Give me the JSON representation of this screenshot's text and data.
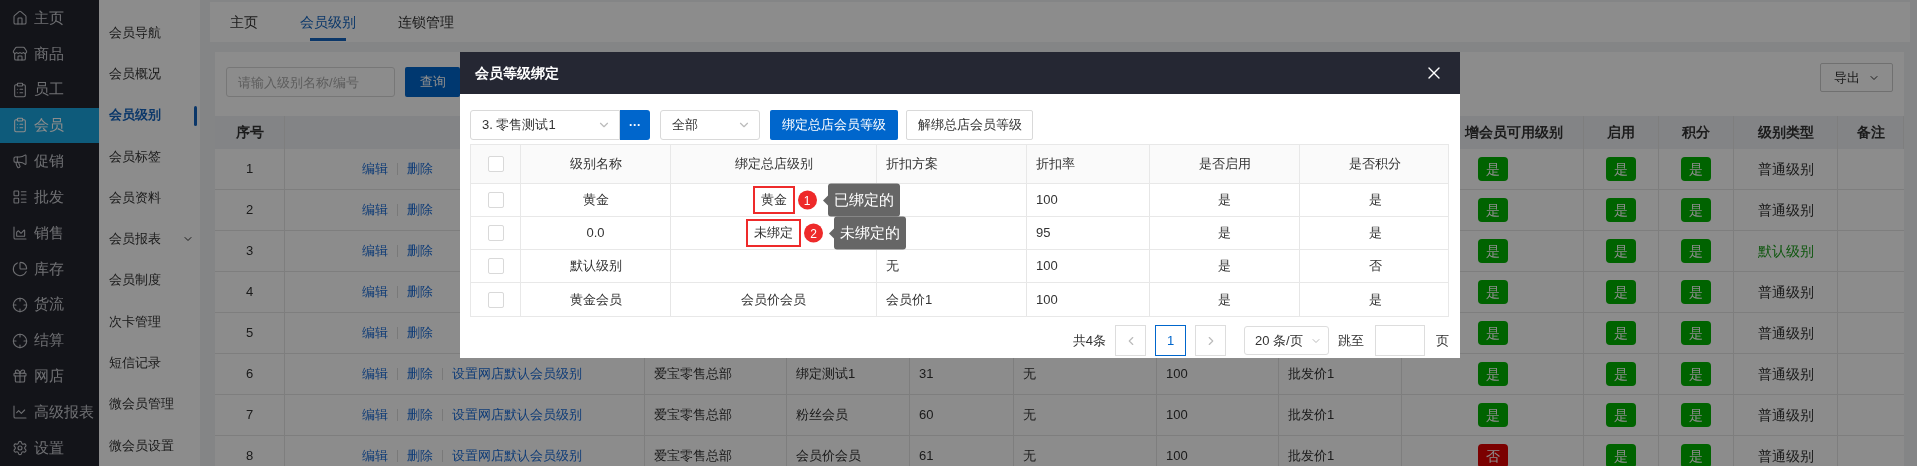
{
  "sidebar": {
    "items": [
      {
        "label": "主页",
        "selected": false
      },
      {
        "label": "商品",
        "selected": false
      },
      {
        "label": "员工",
        "selected": false
      },
      {
        "label": "会员",
        "selected": true
      },
      {
        "label": "促销",
        "selected": false
      },
      {
        "label": "批发",
        "selected": false
      },
      {
        "label": "销售",
        "selected": false
      },
      {
        "label": "库存",
        "selected": false
      },
      {
        "label": "货流",
        "selected": false
      },
      {
        "label": "结算",
        "selected": false
      },
      {
        "label": "网店",
        "selected": false
      },
      {
        "label": "高级报表",
        "selected": false
      },
      {
        "label": "设置",
        "selected": false
      }
    ]
  },
  "subnav": {
    "items": [
      {
        "label": "会员导航",
        "selected": false,
        "expandable": false
      },
      {
        "label": "会员概况",
        "selected": false,
        "expandable": false
      },
      {
        "label": "会员级别",
        "selected": true,
        "expandable": false
      },
      {
        "label": "会员标签",
        "selected": false,
        "expandable": false
      },
      {
        "label": "会员资料",
        "selected": false,
        "expandable": false
      },
      {
        "label": "会员报表",
        "selected": false,
        "expandable": true
      },
      {
        "label": "会员制度",
        "selected": false,
        "expandable": false
      },
      {
        "label": "次卡管理",
        "selected": false,
        "expandable": false
      },
      {
        "label": "短信记录",
        "selected": false,
        "expandable": false
      },
      {
        "label": "微会员管理",
        "selected": false,
        "expandable": false
      },
      {
        "label": "微会员设置",
        "selected": false,
        "expandable": false
      }
    ]
  },
  "tabs": [
    {
      "label": "主页",
      "selected": false
    },
    {
      "label": "会员级别",
      "selected": true
    },
    {
      "label": "连锁管理",
      "selected": false
    }
  ],
  "search": {
    "placeholder": "请输入级别名称/编号",
    "button": "查询"
  },
  "export_button": "导出",
  "table": {
    "columns": {
      "index": "序号",
      "available": "增会员可用级别",
      "enabled": "启用",
      "points": "积分",
      "type": "级别类型",
      "remark": "备注"
    },
    "rows": [
      {
        "index": "1",
        "actions": [
          "编辑",
          "删除"
        ],
        "available": {
          "text": "是",
          "on": true
        },
        "enabled": {
          "text": "是",
          "on": true
        },
        "points": {
          "text": "是",
          "on": true
        },
        "type": {
          "text": "普通级别",
          "default": false
        }
      },
      {
        "index": "2",
        "actions": [
          "编辑",
          "删除"
        ],
        "available": {
          "text": "是",
          "on": true
        },
        "enabled": {
          "text": "是",
          "on": true
        },
        "points": {
          "text": "是",
          "on": true
        },
        "type": {
          "text": "普通级别",
          "default": false
        }
      },
      {
        "index": "3",
        "actions": [
          "编辑",
          "删除"
        ],
        "available": {
          "text": "是",
          "on": true
        },
        "enabled": {
          "text": "是",
          "on": true
        },
        "points": {
          "text": "是",
          "on": true
        },
        "type": {
          "text": "默认级别",
          "default": true
        }
      },
      {
        "index": "4",
        "actions": [
          "编辑",
          "删除"
        ],
        "available": {
          "text": "是",
          "on": true
        },
        "enabled": {
          "text": "是",
          "on": true
        },
        "points": {
          "text": "是",
          "on": true
        },
        "type": {
          "text": "普通级别",
          "default": false
        }
      },
      {
        "index": "5",
        "actions": [
          "编辑",
          "删除"
        ],
        "available": {
          "text": "是",
          "on": true
        },
        "enabled": {
          "text": "是",
          "on": true
        },
        "points": {
          "text": "是",
          "on": true
        },
        "type": {
          "text": "普通级别",
          "default": false
        }
      },
      {
        "index": "6",
        "actions": [
          "编辑",
          "删除",
          "设置网店默认会员级别"
        ],
        "column_3": "爱宝零售总部",
        "column_4": "绑定测试1",
        "column_5": "31",
        "column_6": "无",
        "column_7": "100",
        "column_8": "批发价1",
        "available": {
          "text": "是",
          "on": true
        },
        "enabled": {
          "text": "是",
          "on": true
        },
        "points": {
          "text": "是",
          "on": true
        },
        "type": {
          "text": "普通级别",
          "default": false
        }
      },
      {
        "index": "7",
        "actions": [
          "编辑",
          "删除",
          "设置网店默认会员级别"
        ],
        "column_3": "爱宝零售总部",
        "column_4": "粉丝会员",
        "column_5": "60",
        "column_6": "无",
        "column_7": "100",
        "column_8": "批发价1",
        "available": {
          "text": "是",
          "on": true
        },
        "enabled": {
          "text": "是",
          "on": true
        },
        "points": {
          "text": "是",
          "on": true
        },
        "type": {
          "text": "普通级别",
          "default": false
        }
      },
      {
        "index": "8",
        "actions": [
          "编辑",
          "删除",
          "设置网店默认会员级别"
        ],
        "column_3": "爱宝零售总部",
        "column_4": "会员价会员",
        "column_5": "61",
        "column_6": "无",
        "column_7": "100",
        "column_8": "批发价1",
        "available": {
          "text": "否",
          "on": false
        },
        "enabled": {
          "text": "是",
          "on": true
        },
        "points": {
          "text": "是",
          "on": true
        },
        "type": {
          "text": "普通级别",
          "default": false
        }
      }
    ]
  },
  "modal": {
    "title": "会员等级绑定",
    "store_select": "3. 零售测试1",
    "more_button": "···",
    "filter_select": "全部",
    "bind_button": "绑定总店会员等级",
    "unbind_button": "解绑总店会员等级",
    "all_checked": false,
    "columns": [
      "级别名称",
      "绑定总店级别",
      "折扣方案",
      "折扣率",
      "是否启用",
      "是否积分"
    ],
    "rows": [
      {
        "checked": false,
        "name": "黄金",
        "bound_level": "黄金",
        "annotation": {
          "number": "1",
          "note": "已绑定的"
        },
        "discount_rate": "100",
        "enabled": "是",
        "points": "是"
      },
      {
        "checked": false,
        "name": "0.0",
        "bound_level": "未绑定",
        "annotation": {
          "number": "2",
          "note": "未绑定的"
        },
        "discount_rate": "95",
        "enabled": "是",
        "points": "是"
      },
      {
        "checked": false,
        "name": "默认级别",
        "discount_scheme": "无",
        "discount_rate": "100",
        "enabled": "是",
        "points": "否"
      },
      {
        "checked": false,
        "name": "黄金会员",
        "bound_level": "会员价会员",
        "discount_scheme": "会员价1",
        "discount_rate": "100",
        "enabled": "是",
        "points": "是"
      }
    ],
    "pagination": {
      "total": "共4条",
      "pages": [
        {
          "label": "1",
          "selected": true
        }
      ],
      "page_size": "20 条/页",
      "jump_label": "跳至",
      "page_suffix": "页"
    }
  }
}
